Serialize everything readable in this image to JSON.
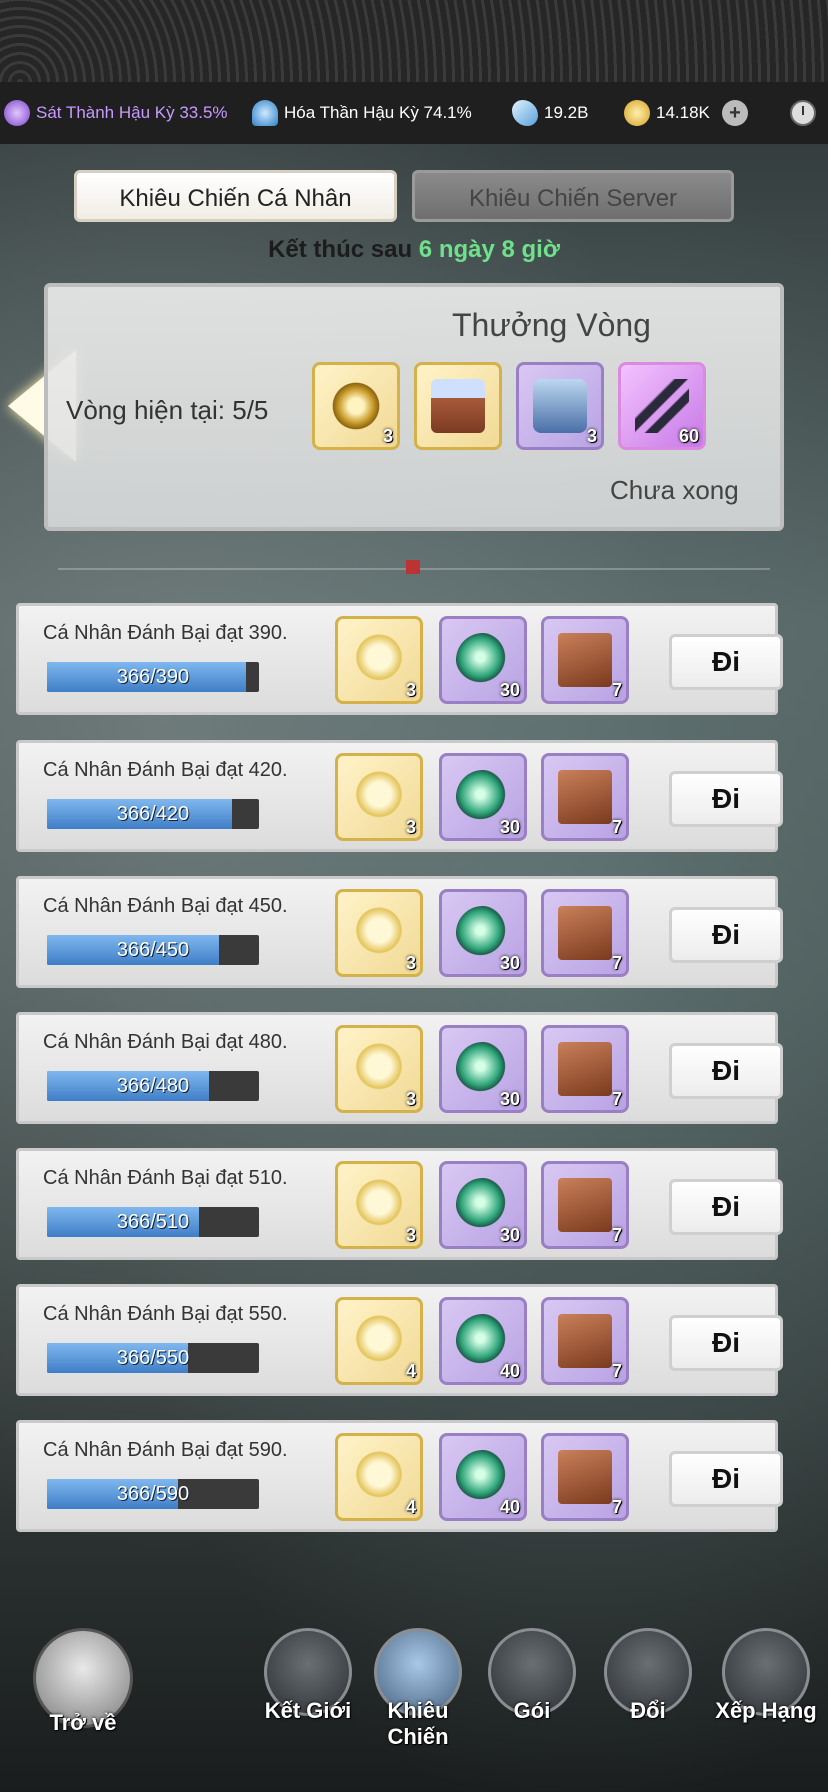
{
  "status_bar": {
    "resource1": {
      "label": "Sát Thành Hậu Kỳ 33.5%",
      "icon": "purple-crystal-icon",
      "color": "#c79bff"
    },
    "resource2": {
      "label": "Hóa Thần Hậu Kỳ 74.1%",
      "icon": "fan-icon"
    },
    "resource3": {
      "label": "19.2B",
      "icon": "spirit-stone-icon"
    },
    "resource4": {
      "label": "14.18K",
      "icon": "coin-icon"
    },
    "plus": "+"
  },
  "tabs": [
    {
      "label": "Khiêu Chiến Cá Nhân",
      "active": true
    },
    {
      "label": "Khiêu Chiến Server",
      "active": false
    }
  ],
  "end_time": {
    "prefix": "Kết thúc sau",
    "value": "6 ngày 8 giờ"
  },
  "round_reward": {
    "title": "Thưởng Vòng",
    "current": "Vòng hiện tại: 5/5",
    "status": "Chưa xong",
    "items": [
      {
        "icon": "golden-ring-icon",
        "count": "3",
        "rarity": "gold"
      },
      {
        "icon": "treasure-chest-icon",
        "count": "",
        "rarity": "gold"
      },
      {
        "icon": "blue-chest-icon",
        "count": "3",
        "rarity": "purple"
      },
      {
        "icon": "dark-blades-icon",
        "count": "60",
        "rarity": "pink"
      }
    ]
  },
  "tasks": [
    {
      "desc": "Cá Nhân Đánh Bại đạt 390.",
      "progress": "366/390",
      "ratio": 0.938,
      "rewards": [
        "3",
        "30",
        "7"
      ],
      "button": "Đi"
    },
    {
      "desc": "Cá Nhân Đánh Bại đạt 420.",
      "progress": "366/420",
      "ratio": 0.871,
      "rewards": [
        "3",
        "30",
        "7"
      ],
      "button": "Đi"
    },
    {
      "desc": "Cá Nhân Đánh Bại đạt 450.",
      "progress": "366/450",
      "ratio": 0.813,
      "rewards": [
        "3",
        "30",
        "7"
      ],
      "button": "Đi"
    },
    {
      "desc": "Cá Nhân Đánh Bại đạt 480.",
      "progress": "366/480",
      "ratio": 0.7625,
      "rewards": [
        "3",
        "30",
        "7"
      ],
      "button": "Đi"
    },
    {
      "desc": "Cá Nhân Đánh Bại đạt 510.",
      "progress": "366/510",
      "ratio": 0.718,
      "rewards": [
        "3",
        "30",
        "7"
      ],
      "button": "Đi"
    },
    {
      "desc": "Cá Nhân Đánh Bại đạt 550.",
      "progress": "366/550",
      "ratio": 0.665,
      "rewards": [
        "4",
        "40",
        "7"
      ],
      "button": "Đi"
    },
    {
      "desc": "Cá Nhân Đánh Bại đạt 590.",
      "progress": "366/590",
      "ratio": 0.62,
      "rewards": [
        "4",
        "40",
        "7"
      ],
      "button": "Đi"
    }
  ],
  "bottom_nav": {
    "back": "Trở về",
    "items": [
      "Kết Giới",
      "Khiêu Chiến",
      "Gói",
      "Đổi",
      "Xếp Hạng"
    ]
  }
}
